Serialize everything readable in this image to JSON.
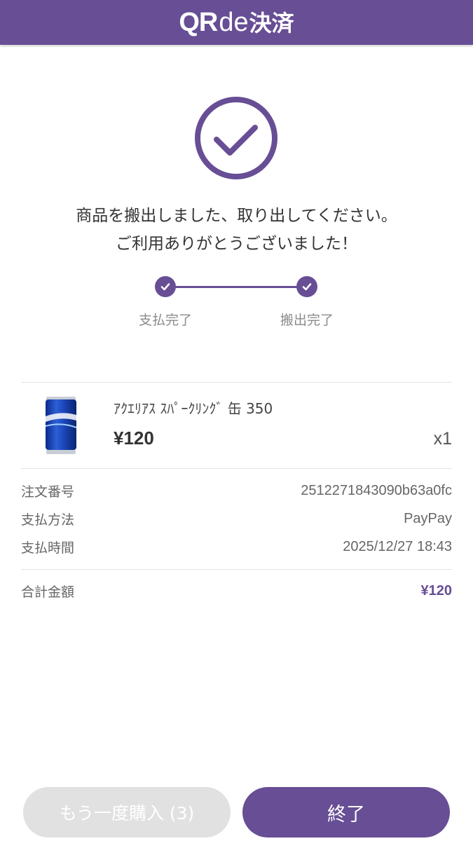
{
  "header": {
    "logo_qr": "QR",
    "logo_de": "de",
    "logo_kessai": "決済",
    "background_color": "#674e95"
  },
  "status": {
    "icon": "check-circle-icon",
    "message_line1": "商品を搬出しました、取り出してください。",
    "message_line2": "ご利用ありがとうございました！"
  },
  "steps": [
    {
      "label": "支払完了",
      "icon": "check-icon",
      "completed": true
    },
    {
      "label": "搬出完了",
      "icon": "check-icon",
      "completed": true
    }
  ],
  "product": {
    "name": "ｱｸｴﾘｱｽ ｽﾊﾟｰｸﾘﾝｸﾞ 缶 350",
    "price": "¥120",
    "quantity": "x1",
    "image_label": "AQUARIUS SPARKLING"
  },
  "order": {
    "order_number_label": "注文番号",
    "order_number": "2512271843090b63a0fc",
    "payment_method_label": "支払方法",
    "payment_method": "PayPay",
    "payment_time_label": "支払時間",
    "payment_time": "2025/12/27 18:43",
    "total_label": "合計金額",
    "total": "¥120"
  },
  "buttons": {
    "buy_again_label": "もう一度購入 (3)",
    "finish_label": "終了"
  },
  "colors": {
    "accent": "#674e95",
    "disabled_button": "#e1e1e1"
  }
}
